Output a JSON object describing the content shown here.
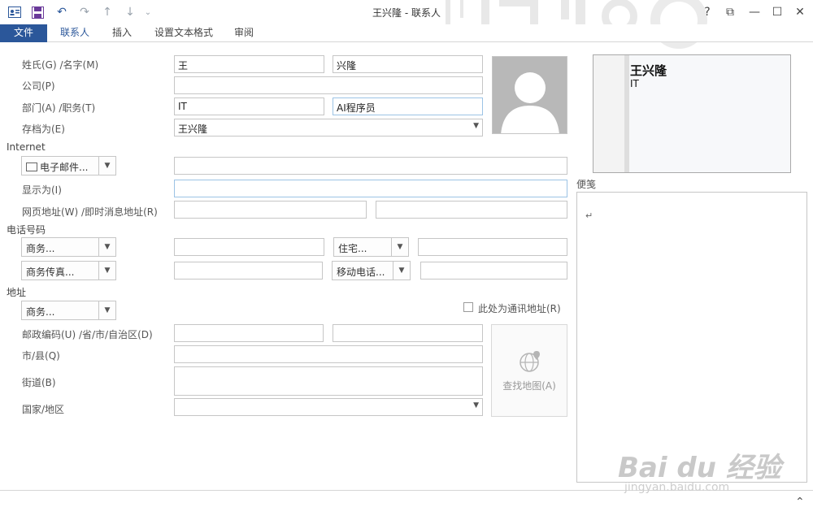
{
  "window": {
    "title": "王兴隆 - 联系人",
    "help": "?",
    "restore_ribbon": "⧉",
    "minimize": "—",
    "maximize": "☐",
    "close": "✕"
  },
  "quick_access": {
    "contact_icon": "contact-card-icon",
    "save_icon": "save-icon",
    "undo_icon": "undo-icon",
    "redo_icon": "redo-icon",
    "up_icon": "arrow-up-icon",
    "down_icon": "arrow-down-icon",
    "customize_icon": "chevron-down-icon"
  },
  "ribbon": {
    "tabs": [
      "文件",
      "联系人",
      "插入",
      "设置文本格式",
      "审阅"
    ]
  },
  "form": {
    "name_label": "姓氏(G)  /名字(M)",
    "last_name": "王",
    "first_name": "兴隆",
    "company_label": "公司(P)",
    "company": "",
    "dept_label": "部门(A)  /职务(T)",
    "department": "IT",
    "job_title": "AI程序员",
    "file_as_label": "存档为(E)",
    "file_as": "王兴隆",
    "internet_section": "Internet",
    "email_button": "电子邮件...",
    "email": "",
    "display_as_label": "显示为(I)",
    "display_as": "",
    "web_label": "网页地址(W)  /即时消息地址(R)",
    "web": "",
    "im": "",
    "phone_section": "电话号码",
    "phone1_button": "商务...",
    "phone1": "",
    "phone2_button": "住宅...",
    "phone2": "",
    "phone3_button": "商务传真...",
    "phone3": "",
    "phone4_button": "移动电话...",
    "phone4": "",
    "address_section": "地址",
    "address_button": "商务...",
    "mailing_checkbox_label": "此处为通讯地址(R)",
    "mailing_checked": false,
    "postal_label": "邮政编码(U)  /省/市/自治区(D)",
    "postal_code": "",
    "province": "",
    "city_label": "市/县(Q)",
    "city": "",
    "street_label": "街道(B)",
    "street": "",
    "country_label": "国家/地区",
    "country": "",
    "map_button": "查找地图(A)"
  },
  "business_card": {
    "name": "王兴隆",
    "department": "IT"
  },
  "notes": {
    "label": "便笺",
    "content": "↵"
  },
  "footer": {
    "collapse": "⌃"
  },
  "watermark": {
    "brand": "Bai du 经验",
    "url": "jingyan.baidu.com"
  },
  "colors": {
    "accent": "#2b579a",
    "border": "#c6c6c6",
    "focus_border": "#9cc3e5"
  }
}
